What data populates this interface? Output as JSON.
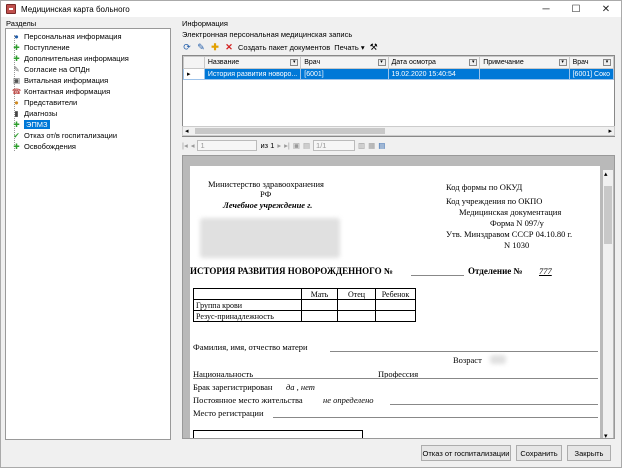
{
  "window": {
    "title": "Медицинская карта больного",
    "controls": [
      "─",
      "☐",
      "✕"
    ]
  },
  "sections_label": "Разделы",
  "tree": [
    {
      "label": "Персональная информация",
      "icon": "patient-icon"
    },
    {
      "label": "Поступление",
      "icon": "green-plus-icon"
    },
    {
      "label": "Дополнительная информация",
      "icon": "green-plus-icon"
    },
    {
      "label": "Согласие на ОПДн",
      "icon": "pen-icon"
    },
    {
      "label": "Витальная информация",
      "icon": "monitor-icon"
    },
    {
      "label": "Контактная информация",
      "icon": "contact-icon"
    },
    {
      "label": "Представители",
      "icon": "people-icon"
    },
    {
      "label": "Диагнозы",
      "icon": "book-icon"
    },
    {
      "label": "ЭПМЗ",
      "icon": "green-plus-icon",
      "selected": true
    },
    {
      "label": "Отказ от/в госпитализации",
      "icon": "check-icon"
    },
    {
      "label": "Освобождения",
      "icon": "green-plus-icon"
    }
  ],
  "info_label": "Информация",
  "record_label": "Электронная персональная медицинская запись",
  "toolbar": {
    "create_package": "Создать пакет документов",
    "print": "Печать"
  },
  "grid": {
    "columns": [
      "Название",
      "Врач",
      "Дата осмотра",
      "Примечание",
      "Врач"
    ],
    "rows": [
      {
        "name": "История развития новоро...",
        "doctor": "[6001]",
        "date": "19.02.2020 15:40:54",
        "note": "",
        "doctor2": "[6001] Соко"
      }
    ]
  },
  "pager": {
    "page": "1",
    "of": "из 1",
    "zoom": "1/1"
  },
  "document": {
    "ministry1": "Министерство здравоохранения",
    "ministry2": "РФ",
    "institution": "Лечебное учреждение г.",
    "okud": "Код формы по ОКУД",
    "okpo": "Код учреждения по ОКПО",
    "med_doc": "Медицинская документация",
    "form": "Форма N 097/у",
    "approved": "Утв. Минздравом СССР 04.10.80 г.",
    "order": "N 1030",
    "heading": "ИСТОРИЯ РАЗВИТИЯ НОВОРОЖДЕННОГО №",
    "dept_label": "Отделение №",
    "dept_value": "777",
    "blood_cols": [
      "",
      "Мать",
      "Отец",
      "Ребенок"
    ],
    "blood_rows": [
      "Группа крови",
      "Резус-принадлежность"
    ],
    "mother_name": "Фамилия, имя, отчество матери",
    "age": "Возраст",
    "nationality": "Национальность",
    "profession": "Профессия",
    "marriage_label": "Брак зарегистрирован",
    "marriage_value": "да , нет",
    "residence_label": "Постоянное место жительства",
    "residence_value": "не определено",
    "registration": "Место регистрации"
  },
  "buttons": {
    "refusal": "Отказ от госпитализации",
    "save": "Сохранить",
    "close": "Закрыть"
  }
}
